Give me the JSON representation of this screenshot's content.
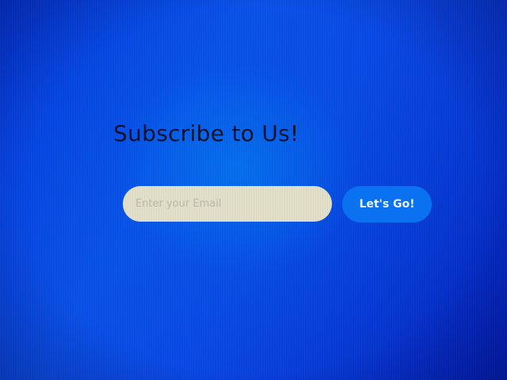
{
  "subscribe": {
    "title": "Subscribe to Us!",
    "email_placeholder": "Enter your Email",
    "email_value": "",
    "button_label": "Let's Go!"
  },
  "colors": {
    "background": "#0a46e2",
    "title_text": "#0c1230",
    "input_background": "#e3e0ca",
    "placeholder_text": "#b9b7a5",
    "button_background": "#0a72f0",
    "button_text": "#e9f1ff"
  }
}
